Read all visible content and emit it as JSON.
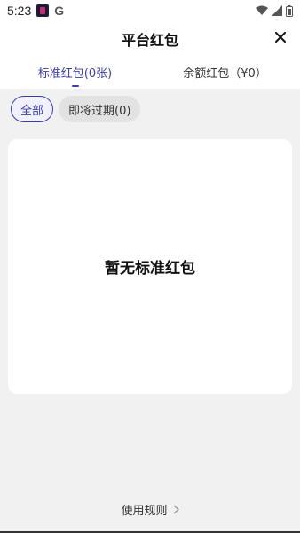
{
  "status_bar": {
    "time": "5:23",
    "icons": [
      "app-icon",
      "google-icon",
      "wifi-icon",
      "signal-icon",
      "battery-icon"
    ]
  },
  "header": {
    "title": "平台红包",
    "close_icon": "close-icon"
  },
  "tabs": [
    {
      "label": "标准红包(0张)",
      "active": true
    },
    {
      "label": "余额红包（¥0）",
      "active": false
    }
  ],
  "filters": [
    {
      "label": "全部",
      "active": true
    },
    {
      "label": "即将过期(0)",
      "active": false
    }
  ],
  "empty_state": {
    "message": "暂无标准红包"
  },
  "footer": {
    "rules_label": "使用规则",
    "chevron_icon": "chevron-right-icon"
  },
  "colors": {
    "accent": "#3a3fa8",
    "background": "#f1f1f1",
    "card": "#ffffff"
  }
}
